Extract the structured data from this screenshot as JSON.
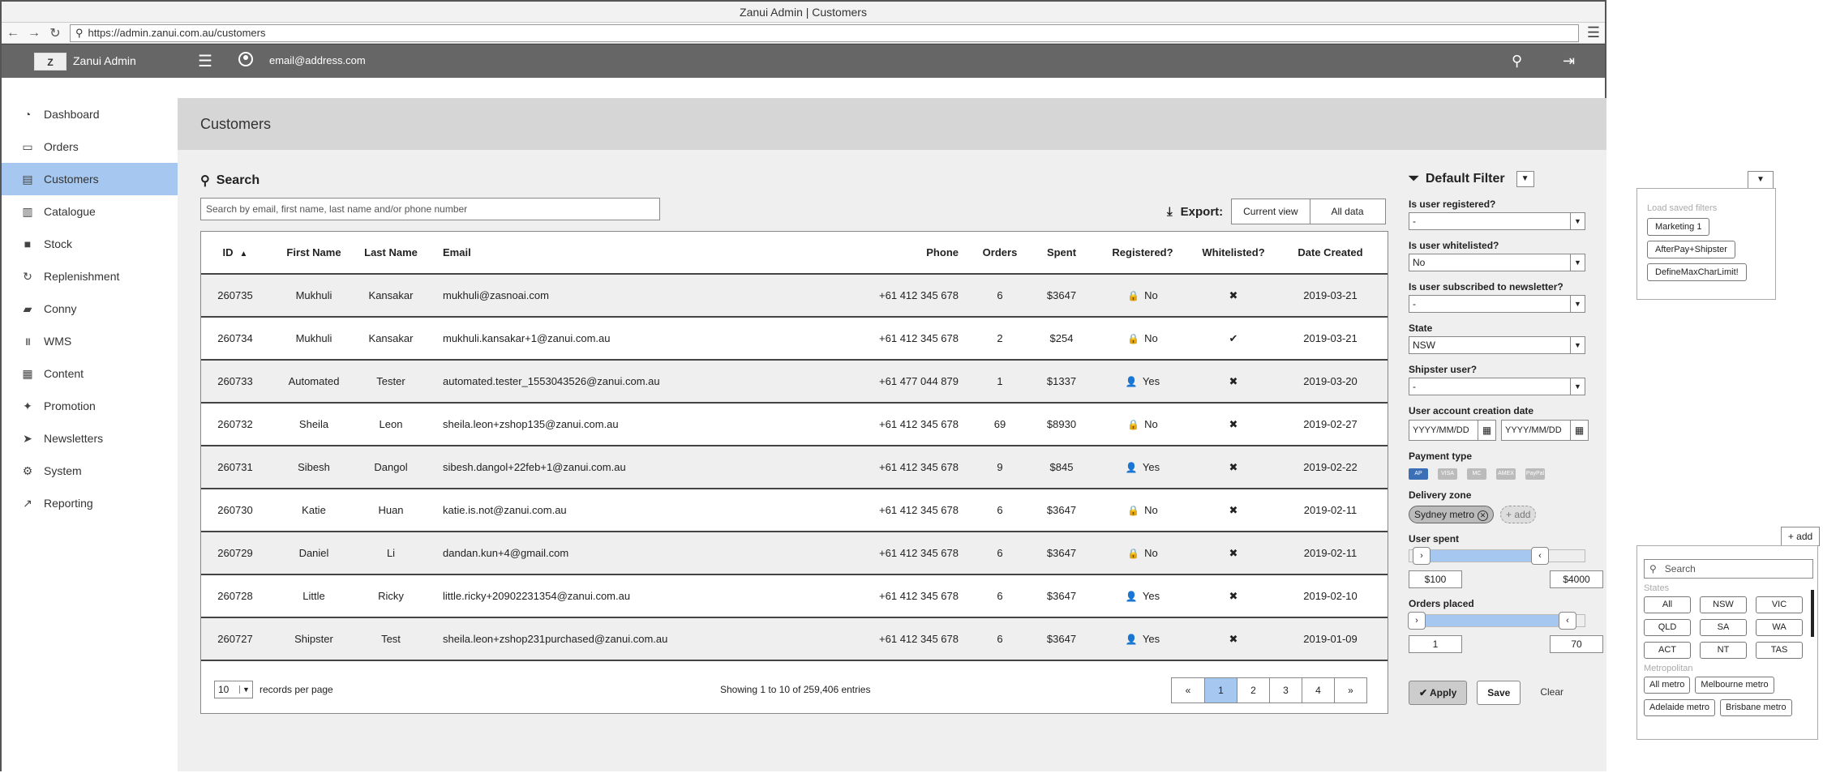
{
  "window": {
    "title": "Zanui Admin | Customers",
    "url": "https://admin.zanui.com.au/customers"
  },
  "appbar": {
    "app_name": "Zanui Admin",
    "logo_text": "Z",
    "user_email": "email@address.com"
  },
  "sidebar": {
    "items": [
      {
        "label": "Dashboard",
        "icon": "dashboard-icon",
        "glyph": "◔"
      },
      {
        "label": "Orders",
        "icon": "basket-icon",
        "glyph": "▭"
      },
      {
        "label": "Customers",
        "icon": "address-card-icon",
        "glyph": "▤",
        "active": true
      },
      {
        "label": "Catalogue",
        "icon": "book-icon",
        "glyph": "▥"
      },
      {
        "label": "Stock",
        "icon": "cube-icon",
        "glyph": "■"
      },
      {
        "label": "Replenishment",
        "icon": "refresh-icon",
        "glyph": "↻"
      },
      {
        "label": "Conny",
        "icon": "truck-icon",
        "glyph": "▰"
      },
      {
        "label": "WMS",
        "icon": "barcode-icon",
        "glyph": "||||"
      },
      {
        "label": "Content",
        "icon": "newspaper-icon",
        "glyph": "▦"
      },
      {
        "label": "Promotion",
        "icon": "gift-icon",
        "glyph": "✦"
      },
      {
        "label": "Newsletters",
        "icon": "paper-plane-icon",
        "glyph": "➤"
      },
      {
        "label": "System",
        "icon": "cogs-icon",
        "glyph": "⚙"
      },
      {
        "label": "Reporting",
        "icon": "line-chart-icon",
        "glyph": "↗"
      }
    ]
  },
  "page": {
    "title": "Customers"
  },
  "search": {
    "title": "Search",
    "placeholder": "Search by email, first name, last name and/or phone number"
  },
  "export": {
    "label": "Export:",
    "current_view": "Current view",
    "all_data": "All data"
  },
  "table": {
    "headers": {
      "id": "ID",
      "first_name": "First Name",
      "last_name": "Last Name",
      "email": "Email",
      "phone": "Phone",
      "orders": "Orders",
      "spent": "Spent",
      "registered": "Registered?",
      "whitelisted": "Whitelisted?",
      "date_created": "Date Created"
    },
    "rows": [
      {
        "id": "260735",
        "first_name": "Mukhuli",
        "last_name": "Kansakar",
        "email": "mukhuli@zasnoai.com",
        "phone": "+61 412 345 678",
        "orders": "6",
        "spent": "$3647",
        "registered": "No",
        "whitelisted": "✖"
      },
      {
        "id": "260734",
        "first_name": "Mukhuli",
        "last_name": "Kansakar",
        "email": "mukhuli.kansakar+1@zanui.com.au",
        "phone": "+61 412 345 678",
        "orders": "2",
        "spent": "$254",
        "registered": "No",
        "whitelisted": "✔"
      },
      {
        "id": "260733",
        "first_name": "Automated",
        "last_name": "Tester",
        "email": "automated.tester_1553043526@zanui.com.au",
        "phone": "+61 477 044 879",
        "orders": "1",
        "spent": "$1337",
        "registered": "Yes",
        "whitelisted": "✖"
      },
      {
        "id": "260732",
        "first_name": "Sheila",
        "last_name": "Leon",
        "email": "sheila.leon+zshop135@zanui.com.au",
        "phone": "+61 412 345 678",
        "orders": "69",
        "spent": "$8930",
        "registered": "No",
        "whitelisted": "✖"
      },
      {
        "id": "260731",
        "first_name": "Sibesh",
        "last_name": "Dangol",
        "email": "sibesh.dangol+22feb+1@zanui.com.au",
        "phone": "+61 412 345 678",
        "orders": "9",
        "spent": "$845",
        "registered": "Yes",
        "whitelisted": "✖"
      },
      {
        "id": "260730",
        "first_name": "Katie",
        "last_name": "Huan",
        "email": "katie.is.not@zanui.com.au",
        "phone": "+61 412 345 678",
        "orders": "6",
        "spent": "$3647",
        "registered": "No",
        "whitelisted": "✖"
      },
      {
        "id": "260729",
        "first_name": "Daniel",
        "last_name": "Li",
        "email": "dandan.kun+4@gmail.com",
        "phone": "+61 412 345 678",
        "orders": "6",
        "spent": "$3647",
        "registered": "No",
        "whitelisted": "✖"
      },
      {
        "id": "260728",
        "first_name": "Little",
        "last_name": "Ricky",
        "email": "little.ricky+20902231354@zanui.com.au",
        "phone": "+61 412 345 678",
        "orders": "6",
        "spent": "$3647",
        "registered": "Yes",
        "whitelisted": "✖"
      },
      {
        "id": "260727",
        "first_name": "Shipster",
        "last_name": "Test",
        "email": "sheila.leon+zshop231purchased@zanui.com.au",
        "phone": "+61 412 345 678",
        "orders": "6",
        "spent": "$3647",
        "registered": "Yes",
        "whitelisted": "✖"
      }
    ],
    "dates": [
      "2019-03-21",
      "2019-03-21",
      "2019-03-20",
      "2019-02-27",
      "2019-02-22",
      "2019-02-11",
      "2019-02-11",
      "2019-02-10",
      "2019-01-09"
    ]
  },
  "footer": {
    "per_page": "10",
    "per_page_label": "records per page",
    "showing": "Showing 1 to 10 of 259,406 entries",
    "pages": [
      "«",
      "1",
      "2",
      "3",
      "4",
      "»"
    ]
  },
  "filter": {
    "title": "Default Filter",
    "registered_label": "Is user registered?",
    "registered_value": "-",
    "whitelisted_label": "Is user whitelisted?",
    "whitelisted_value": "No",
    "newsletter_label": "Is user subscribed to newsletter?",
    "newsletter_value": "-",
    "state_label": "State",
    "state_value": "NSW",
    "shipster_label": "Shipster user?",
    "shipster_value": "-",
    "date_label": "User account creation date",
    "date_placeholder": "YYYY/MM/DD",
    "payment_label": "Payment type",
    "payment_types": [
      "AP",
      "VISA",
      "MC",
      "AMEX",
      "PayPal"
    ],
    "zone_label": "Delivery zone",
    "zone_chip": "Sydney metro",
    "zone_add": "+ add",
    "spent_label": "User spent",
    "spent_min": "$100",
    "spent_max": "$4000",
    "orders_label": "Orders placed",
    "orders_min": "1",
    "orders_max": "70",
    "apply": "Apply",
    "save": "Save",
    "clear": "Clear"
  },
  "saved_filters": {
    "label": "Load saved filters",
    "items": [
      "Marketing 1",
      "AfterPay+Shipster",
      "DefineMaxCharLimit!"
    ]
  },
  "zone_picker": {
    "add": "+ add",
    "search_placeholder": "Search",
    "states_label": "States",
    "states": [
      "All",
      "NSW",
      "VIC",
      "QLD",
      "SA",
      "WA",
      "ACT",
      "NT",
      "TAS"
    ],
    "metro_label": "Metropolitan",
    "metro": [
      "All metro",
      "Melbourne metro",
      "Adelaide metro",
      "Brisbane metro"
    ]
  },
  "colors": {
    "accent": "#a6c8f0",
    "appbar": "#666666",
    "pagehead": "#d6d6d6"
  }
}
